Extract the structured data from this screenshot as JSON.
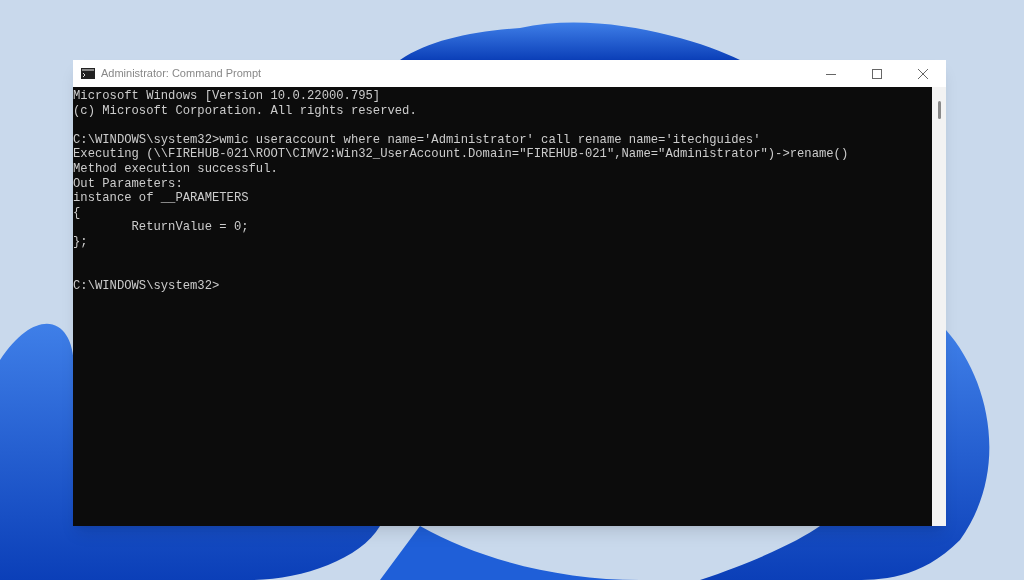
{
  "window": {
    "title": "Administrator: Command Prompt"
  },
  "console": {
    "lines": [
      {
        "kind": "text",
        "text": "Microsoft Windows [Version 10.0.22000.795]"
      },
      {
        "kind": "text",
        "text": "(c) Microsoft Corporation. All rights reserved."
      },
      {
        "kind": "blank"
      },
      {
        "kind": "text",
        "text": "C:\\WINDOWS\\system32>wmic useraccount where name='Administrator' call rename name='itechguides'"
      },
      {
        "kind": "text",
        "text": "Executing (\\\\FIREHUB-021\\ROOT\\CIMV2:Win32_UserAccount.Domain=\"FIREHUB-021\",Name=\"Administrator\")->rename()"
      },
      {
        "kind": "text",
        "text": "Method execution successful."
      },
      {
        "kind": "text",
        "text": "Out Parameters:"
      },
      {
        "kind": "text",
        "text": "instance of __PARAMETERS"
      },
      {
        "kind": "text",
        "text": "{"
      },
      {
        "kind": "text",
        "text": "\tReturnValue = 0;"
      },
      {
        "kind": "text",
        "text": "};"
      },
      {
        "kind": "blank"
      },
      {
        "kind": "blank"
      },
      {
        "kind": "text",
        "text": "C:\\WINDOWS\\system32>"
      }
    ]
  }
}
